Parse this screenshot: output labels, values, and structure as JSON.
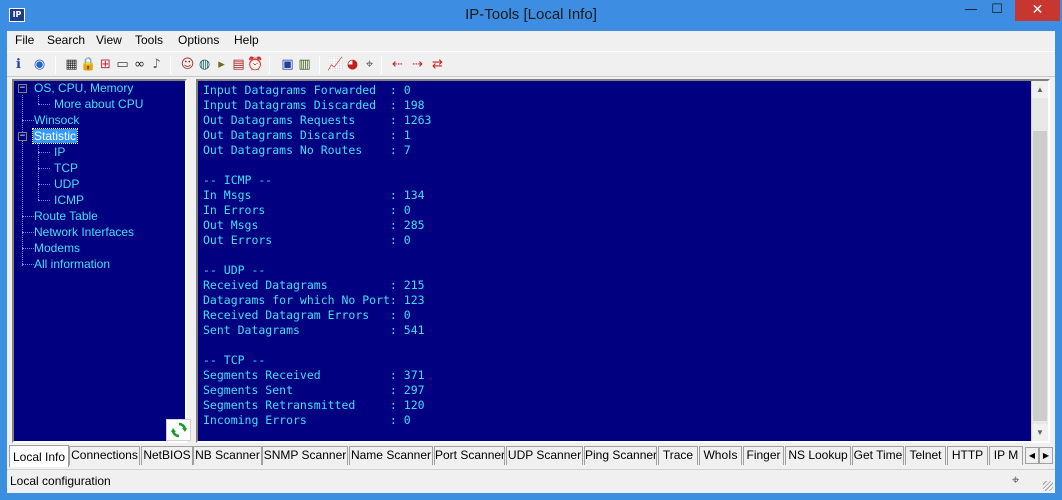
{
  "window": {
    "title": "IP-Tools [Local Info]",
    "app_icon": "IP",
    "min": "—",
    "max": "☐",
    "close": "✕"
  },
  "menu": [
    "File",
    "Search",
    "View",
    "Tools",
    "Options",
    "Help"
  ],
  "toolbar_icons": [
    {
      "name": "info-icon",
      "glyph": "ℹ",
      "color": "#1a3fa8"
    },
    {
      "name": "globe-user-icon",
      "glyph": "◉",
      "color": "#2266cc"
    },
    {
      "name": "table-icon",
      "glyph": "▦",
      "color": "#303030"
    },
    {
      "name": "lock-icon",
      "glyph": "🔒",
      "color": "#806000"
    },
    {
      "name": "network-icon",
      "glyph": "⊞",
      "color": "#c03030"
    },
    {
      "name": "book-icon",
      "glyph": "▭",
      "color": "#404040"
    },
    {
      "name": "binoculars-icon",
      "glyph": "∞",
      "color": "#202020"
    },
    {
      "name": "speaker-icon",
      "glyph": "♪",
      "color": "#606060"
    },
    {
      "name": "people-icon",
      "glyph": "☺",
      "color": "#a03030"
    },
    {
      "name": "globe-icon",
      "glyph": "◍",
      "color": "#206060"
    },
    {
      "name": "flashlight-icon",
      "glyph": "▸",
      "color": "#707020"
    },
    {
      "name": "printer-icon",
      "glyph": "▤",
      "color": "#b02020"
    },
    {
      "name": "alarm-clock-icon",
      "glyph": "⏰",
      "color": "#b02020"
    },
    {
      "name": "computer-icon",
      "glyph": "▣",
      "color": "#2040a0"
    },
    {
      "name": "notepad-icon",
      "glyph": "▥",
      "color": "#406020"
    },
    {
      "name": "chart-icon",
      "glyph": "📈",
      "color": "#306090"
    },
    {
      "name": "pie-chart-icon",
      "glyph": "◕",
      "color": "#c02020"
    },
    {
      "name": "satellite-dish-icon",
      "glyph": "⌖",
      "color": "#505050"
    },
    {
      "name": "arrow-left-icon",
      "glyph": "⇠",
      "color": "#d02020"
    },
    {
      "name": "arrow-right-icon",
      "glyph": "⇢",
      "color": "#d02020"
    },
    {
      "name": "connect-icon",
      "glyph": "⇄",
      "color": "#d02020"
    }
  ],
  "tree": {
    "items": [
      {
        "label": "OS, CPU, Memory",
        "expander": "−"
      },
      {
        "label": "More about CPU"
      },
      {
        "label": "Winsock"
      },
      {
        "label": "Statistic",
        "expander": "−"
      },
      {
        "label": "IP"
      },
      {
        "label": "TCP"
      },
      {
        "label": "UDP"
      },
      {
        "label": "ICMP"
      },
      {
        "label": "Route Table"
      },
      {
        "label": "Network Interfaces"
      },
      {
        "label": "Modems"
      },
      {
        "label": "All information"
      }
    ]
  },
  "content": {
    "lines": [
      "Input Datagrams Forwarded  : 0",
      "Input Datagrams Discarded  : 198",
      "Out Datagrams Requests     : 1263",
      "Out Datagrams Discards     : 1",
      "Out Datagrams No Routes    : 7",
      "",
      "-- ICMP --",
      "In Msgs                    : 134",
      "In Errors                  : 0",
      "Out Msgs                   : 285",
      "Out Errors                 : 0",
      "",
      "-- UDP --",
      "Received Datagrams         : 215",
      "Datagrams for which No Port: 123",
      "Received Datagram Errors   : 0",
      "Sent Datagrams             : 541",
      "",
      "-- TCP --",
      "Segments Received          : 371",
      "Segments Sent              : 297",
      "Segments Retransmitted     : 120",
      "Incoming Errors            : 0"
    ],
    "scroll_up": "▲",
    "scroll_down": "▼"
  },
  "tabs": {
    "items": [
      "Local Info",
      "Connections",
      "NetBIOS",
      "NB Scanner",
      "SNMP Scanner",
      "Name Scanner",
      "Port Scanner",
      "UDP Scanner",
      "Ping Scanner",
      "Trace",
      "WhoIs",
      "Finger",
      "NS Lookup",
      "Get Time",
      "Telnet",
      "HTTP",
      "IP M"
    ],
    "active": "Local Info",
    "scroll_left": "◀",
    "scroll_right": "▶"
  },
  "status": {
    "text": "Local configuration",
    "icon": "satellite-dish-icon",
    "icon_glyph": "⌖"
  },
  "colors": {
    "panel_bg": "#000080",
    "panel_text": "#40e0f8",
    "titlebar": "#3d8ee2",
    "selection": "#3399ff"
  }
}
